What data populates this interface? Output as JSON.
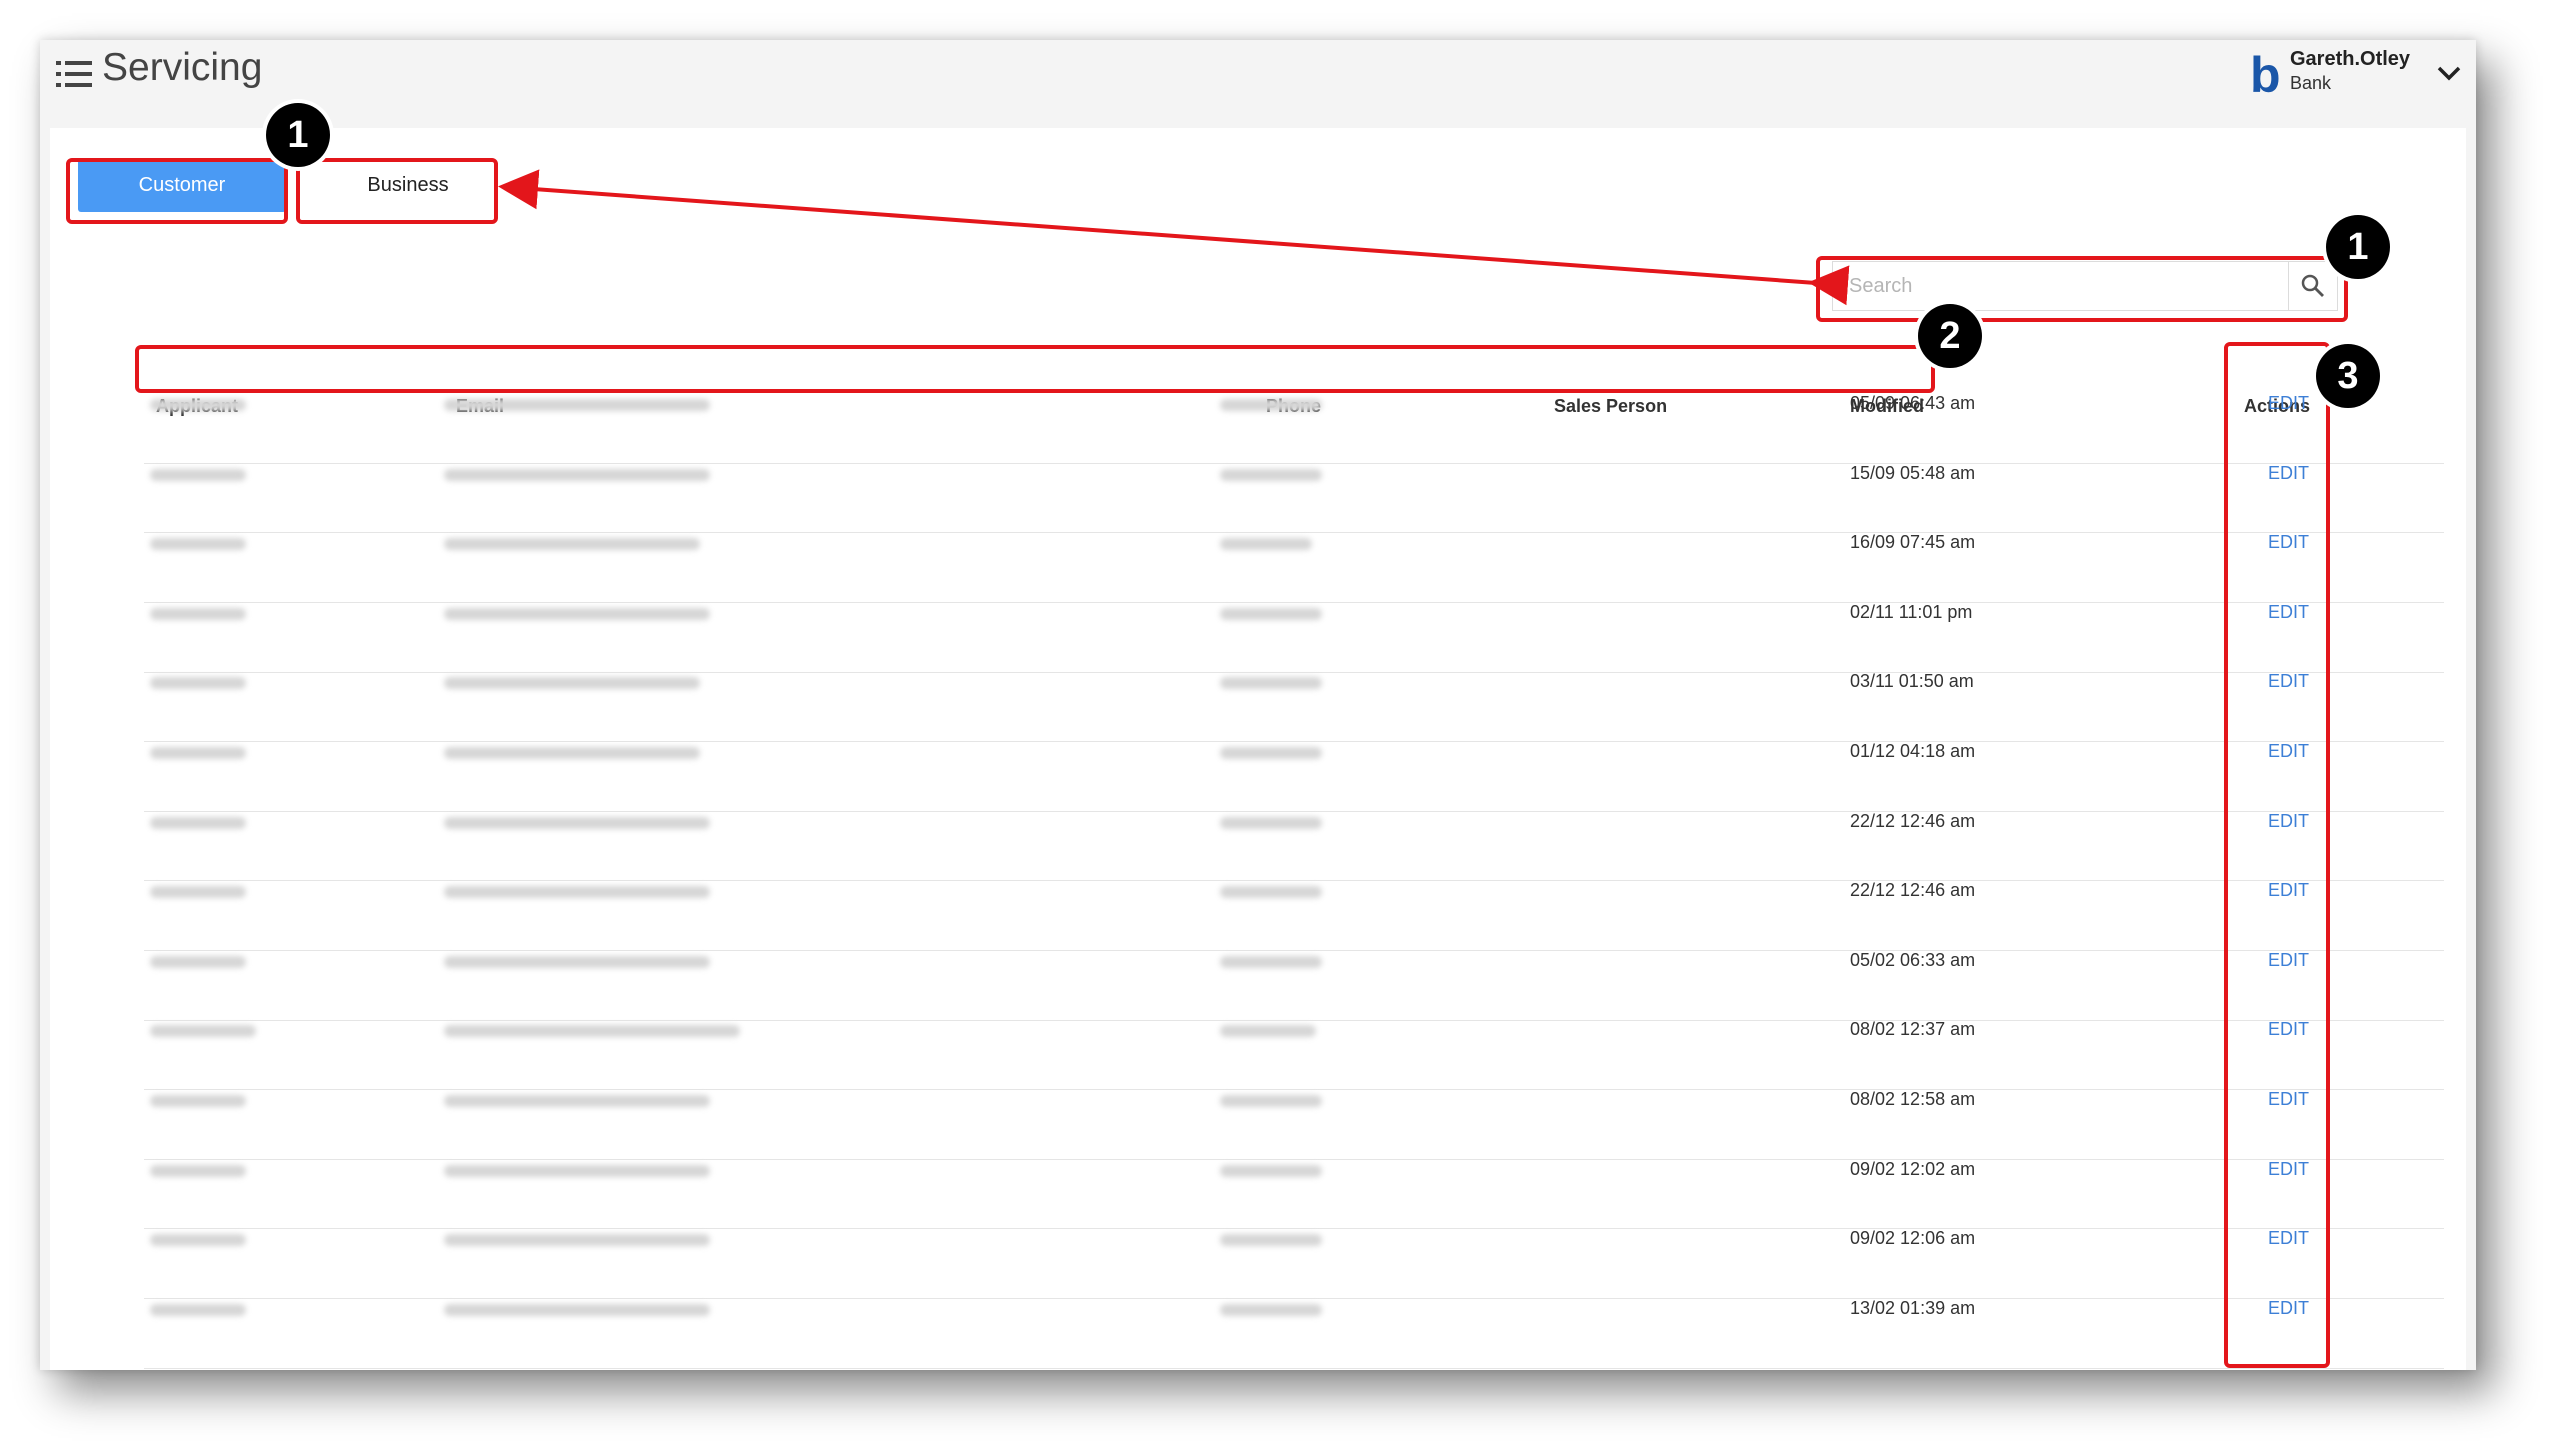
{
  "header": {
    "title": "Servicing",
    "brand_letter": "b",
    "user_name": "Gareth.Otley",
    "user_org": "Bank"
  },
  "tabs": [
    {
      "label": "Customer",
      "active": true
    },
    {
      "label": "Business",
      "active": false
    }
  ],
  "search": {
    "placeholder": "Search",
    "value": ""
  },
  "table": {
    "columns": {
      "applicant": "Applicant",
      "email": "Email",
      "phone": "Phone",
      "sales_person": "Sales Person",
      "modified": "Modified",
      "actions": "Actions"
    },
    "rows": [
      {
        "modified": "05/09 06:43 am",
        "action": "EDIT"
      },
      {
        "modified": "15/09 05:48 am",
        "action": "EDIT"
      },
      {
        "modified": "16/09 07:45 am",
        "action": "EDIT"
      },
      {
        "modified": "02/11 11:01 pm",
        "action": "EDIT"
      },
      {
        "modified": "03/11 01:50 am",
        "action": "EDIT"
      },
      {
        "modified": "01/12 04:18 am",
        "action": "EDIT"
      },
      {
        "modified": "22/12 12:46 am",
        "action": "EDIT"
      },
      {
        "modified": "22/12 12:46 am",
        "action": "EDIT"
      },
      {
        "modified": "05/02 06:33 am",
        "action": "EDIT"
      },
      {
        "modified": "08/02 12:37 am",
        "action": "EDIT"
      },
      {
        "modified": "08/02 12:58 am",
        "action": "EDIT"
      },
      {
        "modified": "09/02 12:02 am",
        "action": "EDIT"
      },
      {
        "modified": "09/02 12:06 am",
        "action": "EDIT"
      },
      {
        "modified": "13/02 01:39 am",
        "action": "EDIT"
      }
    ]
  },
  "annotations": {
    "badges": [
      "1",
      "1",
      "2",
      "3"
    ],
    "callout_color": "#e3161b"
  },
  "colors": {
    "accent": "#4a9af4",
    "link": "#3d7fd6",
    "brand": "#1a56a8"
  }
}
